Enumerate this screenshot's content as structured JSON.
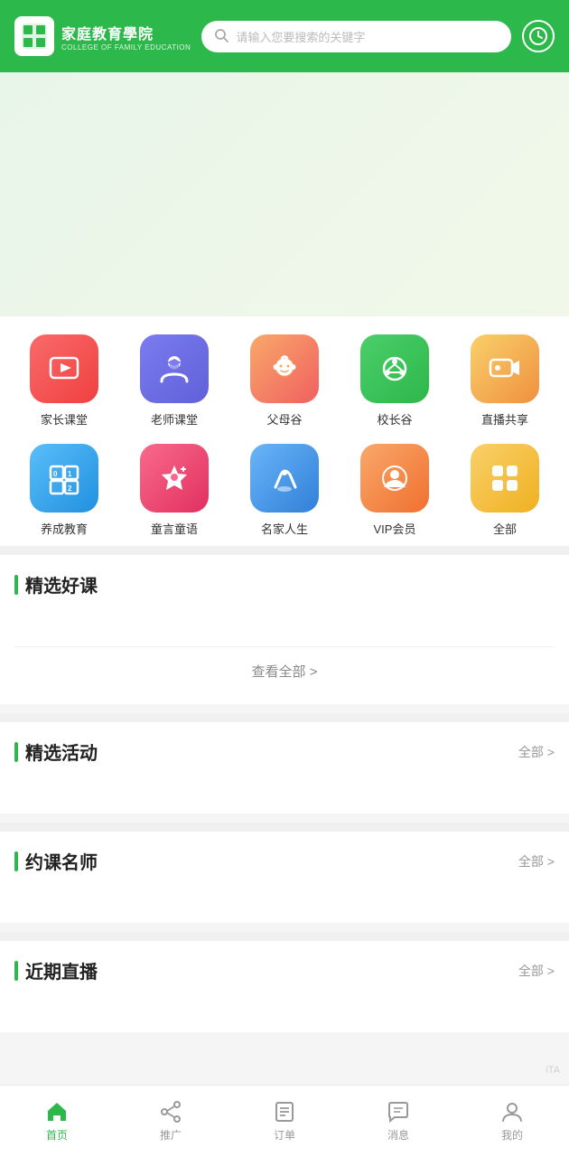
{
  "header": {
    "logo_title": "家庭教育學院",
    "logo_subtitle": "COLLEGE OF FAMILY EDUCATION",
    "search_placeholder": "请输入您要搜索的关键字"
  },
  "icon_grid": {
    "items": [
      {
        "id": "jiazhang",
        "label": "家长课堂",
        "color": "icon-red",
        "icon": "video"
      },
      {
        "id": "laoshi",
        "label": "老师课堂",
        "color": "icon-blue-purple",
        "icon": "graduation"
      },
      {
        "id": "fumu",
        "label": "父母谷",
        "color": "icon-orange-pink",
        "icon": "baby"
      },
      {
        "id": "xiaozhang",
        "label": "校长谷",
        "color": "icon-green",
        "icon": "cycle"
      },
      {
        "id": "zhibo",
        "label": "直播共享",
        "color": "icon-yellow-orange",
        "icon": "livevideo"
      },
      {
        "id": "yangcheng",
        "label": "养成教育",
        "color": "icon-blue",
        "icon": "numbers"
      },
      {
        "id": "tongyan",
        "label": "童言童语",
        "color": "icon-red2",
        "icon": "star"
      },
      {
        "id": "mingjia",
        "label": "名家人生",
        "color": "icon-blue2",
        "icon": "pen"
      },
      {
        "id": "vip",
        "label": "VIP会员",
        "color": "icon-orange",
        "icon": "vip"
      },
      {
        "id": "all",
        "label": "全部",
        "color": "icon-yellow",
        "icon": "grid"
      }
    ]
  },
  "sections": {
    "jingxuan": {
      "title": "精选好课",
      "view_all_label": "查看全部 >"
    },
    "activities": {
      "title": "精选活动",
      "more_label": "全部 >"
    },
    "teachers": {
      "title": "约课名师",
      "more_label": "全部 >"
    },
    "live": {
      "title": "近期直播",
      "more_label": "全部 >"
    }
  },
  "bottom_nav": {
    "items": [
      {
        "id": "home",
        "label": "首页",
        "active": true
      },
      {
        "id": "promote",
        "label": "推广",
        "active": false
      },
      {
        "id": "order",
        "label": "订单",
        "active": false
      },
      {
        "id": "message",
        "label": "消息",
        "active": false
      },
      {
        "id": "profile",
        "label": "我的",
        "active": false
      }
    ]
  },
  "watermark": {
    "text": "iTA"
  }
}
